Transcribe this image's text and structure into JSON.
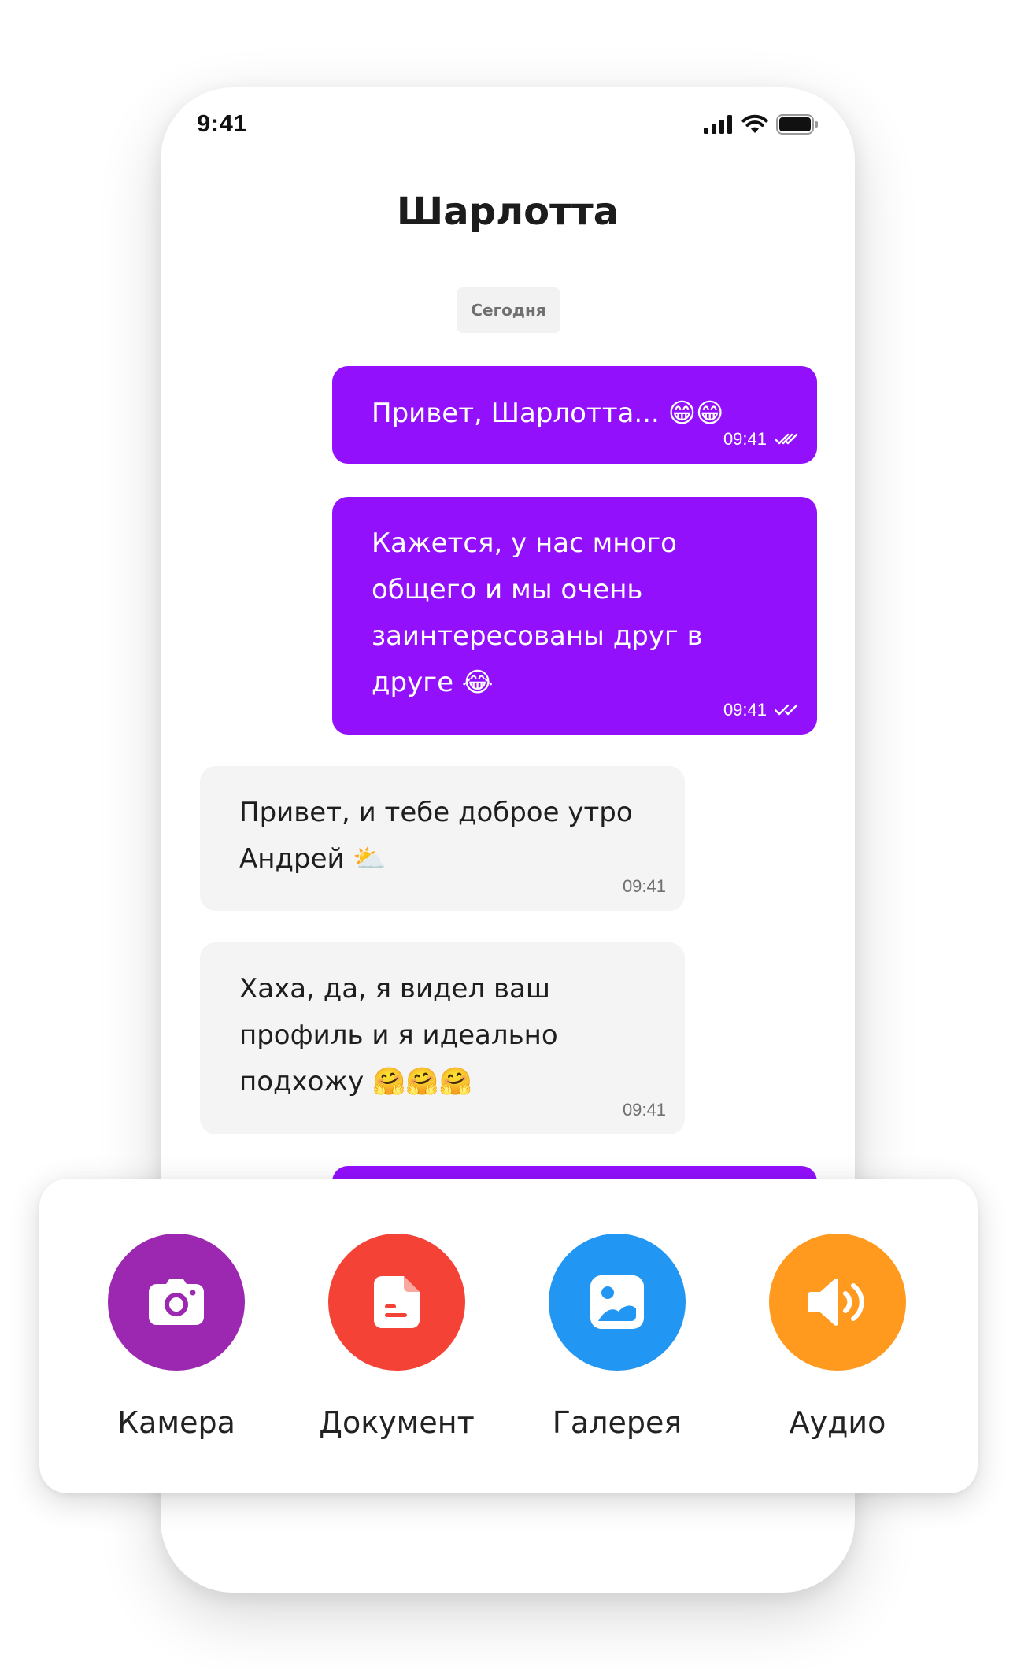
{
  "status_bar": {
    "time": "9:41",
    "icons": [
      "signal-icon",
      "wifi-icon",
      "battery-icon"
    ]
  },
  "chat": {
    "title": "Шарлотта",
    "date_label": "Сегодня",
    "messages": [
      {
        "direction": "outgoing",
        "text": "Привет, Шарлотта... 😁😁",
        "time": "09:41",
        "read": true
      },
      {
        "direction": "outgoing",
        "text": "Кажется, у нас много\nобщего и мы очень\nзаинтересованы друг в\nдруге 😂",
        "time": "09:41",
        "read": true
      },
      {
        "direction": "incoming",
        "text": "Привет, и тебе доброе утро\nАндрей ⛅",
        "time": "09:41"
      },
      {
        "direction": "incoming",
        "text": "Хаха, да, я видел ваш\nпрофиль и я идеально\nподхожу 🤗🤗🤗",
        "time": "09:41"
      },
      {
        "direction": "outgoing",
        "text": "",
        "time": ""
      }
    ]
  },
  "attach_menu": {
    "items": [
      {
        "label": "Камера",
        "icon": "camera-icon",
        "color": "#9c27b0"
      },
      {
        "label": "Документ",
        "icon": "document-icon",
        "color": "#f44336"
      },
      {
        "label": "Галерея",
        "icon": "gallery-icon",
        "color": "#2196f3"
      },
      {
        "label": "Аудио",
        "icon": "audio-icon",
        "color": "#ff9a1f"
      }
    ]
  },
  "colors": {
    "accent": "#9310fd",
    "incoming_bubble": "#f4f4f4"
  }
}
